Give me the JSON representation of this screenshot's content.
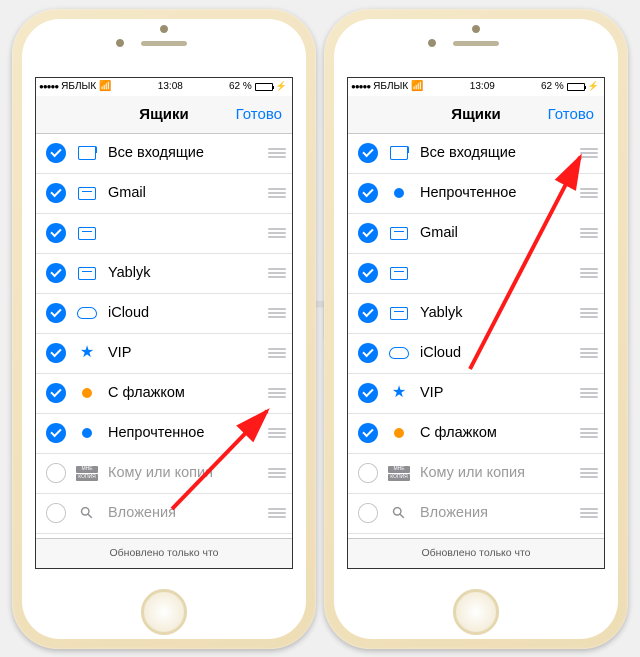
{
  "watermark": "Яблык",
  "left": {
    "status": {
      "carrier": "ЯБЛЫК",
      "time": "13:08",
      "battery_pct": "62 %"
    },
    "nav": {
      "title": "Ящики",
      "done": "Готово"
    },
    "footer": "Обновлено только что",
    "rows": [
      {
        "checked": true,
        "icon": "inbox",
        "label": "Все входящие"
      },
      {
        "checked": true,
        "icon": "tray",
        "label": "Gmail"
      },
      {
        "checked": true,
        "icon": "tray",
        "label": "",
        "blurred": true
      },
      {
        "checked": true,
        "icon": "tray",
        "label": "Yablyk"
      },
      {
        "checked": true,
        "icon": "cloud",
        "label": "iCloud"
      },
      {
        "checked": true,
        "icon": "star",
        "label": "VIP"
      },
      {
        "checked": true,
        "icon": "flag",
        "label": "С флажком"
      },
      {
        "checked": true,
        "icon": "unread",
        "label": "Непрочтенное"
      },
      {
        "checked": false,
        "icon": "badge",
        "label": "Кому или копия",
        "dim": true
      },
      {
        "checked": false,
        "icon": "clip",
        "label": "Вложения",
        "dim": true
      }
    ]
  },
  "right": {
    "status": {
      "carrier": "ЯБЛЫК",
      "time": "13:09",
      "battery_pct": "62 %"
    },
    "nav": {
      "title": "Ящики",
      "done": "Готово"
    },
    "footer": "Обновлено только что",
    "rows": [
      {
        "checked": true,
        "icon": "inbox",
        "label": "Все входящие"
      },
      {
        "checked": true,
        "icon": "unread",
        "label": "Непрочтенное"
      },
      {
        "checked": true,
        "icon": "tray",
        "label": "Gmail"
      },
      {
        "checked": true,
        "icon": "tray",
        "label": "",
        "blurred": true
      },
      {
        "checked": true,
        "icon": "tray",
        "label": "Yablyk"
      },
      {
        "checked": true,
        "icon": "cloud",
        "label": "iCloud"
      },
      {
        "checked": true,
        "icon": "star",
        "label": "VIP"
      },
      {
        "checked": true,
        "icon": "flag",
        "label": "С флажком"
      },
      {
        "checked": false,
        "icon": "badge",
        "label": "Кому или копия",
        "dim": true
      },
      {
        "checked": false,
        "icon": "clip",
        "label": "Вложения",
        "dim": true
      }
    ]
  },
  "badge_text": {
    "t": "МНЕ",
    "b": "КОПИЯ"
  }
}
